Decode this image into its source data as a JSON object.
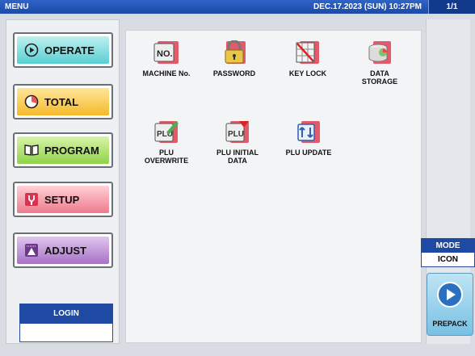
{
  "header": {
    "menu_label": "MENU",
    "datetime": "DEC.17.2023 (SUN)  10:27PM",
    "page": "1/1"
  },
  "nav": {
    "operate": "OPERATE",
    "total": "TOTAL",
    "program": "PROGRAM",
    "setup": "SETUP",
    "adjust": "ADJUST"
  },
  "login": {
    "label": "LOGIN"
  },
  "tiles": {
    "machine_no": "MACHINE No.",
    "password": "PASSWORD",
    "key_lock": "KEY LOCK",
    "data_storage": "DATA\nSTORAGE",
    "plu_overwrite": "PLU\nOVERWRITE",
    "plu_initial": "PLU INITIAL\nDATA",
    "plu_update": "PLU UPDATE"
  },
  "mode": {
    "label": "MODE",
    "value": "ICON"
  },
  "prepack": {
    "label": "PREPACK"
  }
}
